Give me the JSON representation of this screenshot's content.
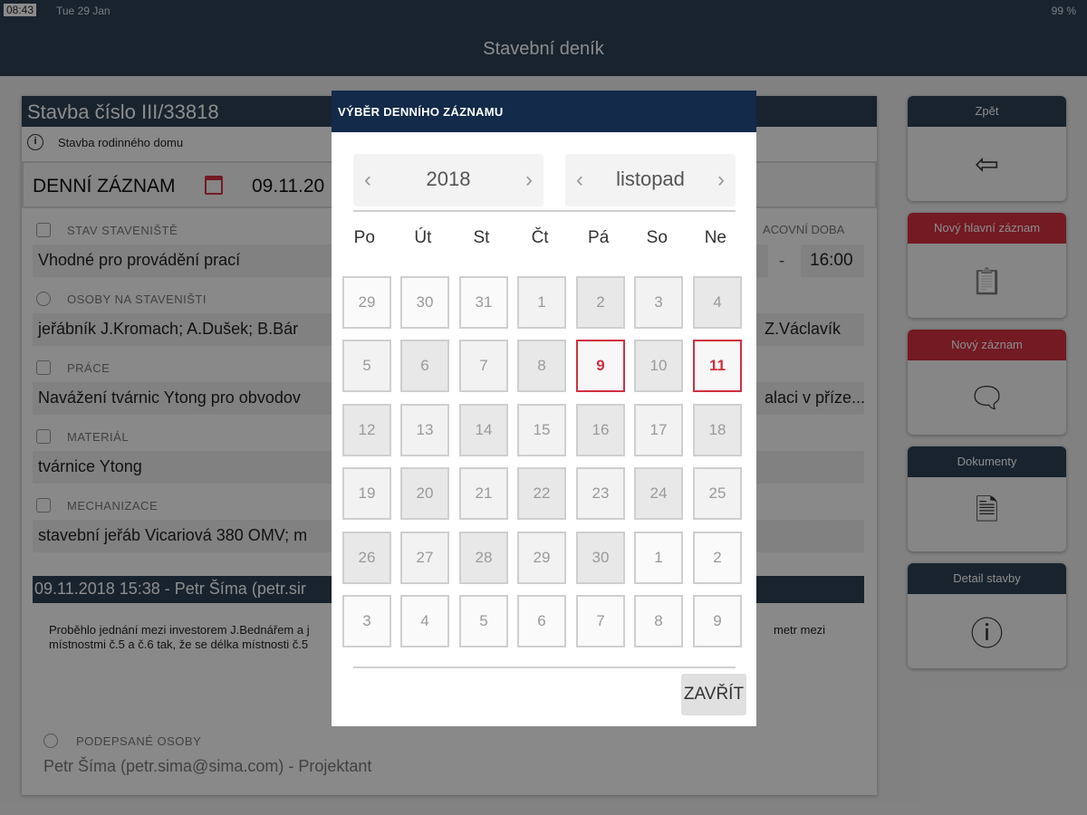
{
  "status": {
    "time": "08:43",
    "date": "Tue 29 Jan",
    "battery": "99 %"
  },
  "nav": {
    "title": "Stavební deník"
  },
  "project": {
    "title": "Stavba číslo III/33818",
    "subtitle": "Stavba rodinného domu",
    "day_record_label": "DENNÍ ZÁZNAM",
    "day_record_date": "09.11.20",
    "sections": {
      "site_state": {
        "label": "STAV STAVENIŠTĚ",
        "value": "Vhodné pro provádění prací"
      },
      "persons": {
        "label": "OSOBY NA STAVENIŠTI",
        "value": "jeřábník J.Kromach;  A.Dušek;  B.Bár",
        "value_right": "Z.Václavík"
      },
      "work": {
        "label": "PRÁCE",
        "value": "Navážení tvárnic Ytong pro obvodov",
        "value_right": "alaci v přízе..."
      },
      "material": {
        "label": "MATERIÁL",
        "value": "tvárnice Ytong"
      },
      "machinery": {
        "label": "MECHANIZACE",
        "value": "stavební jeřáb Vicariová 380 OMV;  m"
      }
    },
    "work_time": {
      "label": "ACOVNÍ DOBA",
      "dash": "-",
      "end": "16:00"
    },
    "entry": {
      "header": "09.11.2018 15:38 - Petr Šíma (petr.sir",
      "text_line1": "Proběhlo jednání mezi investorem J.Bednářem a j",
      "text_line1_right": "metr mezi",
      "text_line2": "místnostmi č.5 a č.6 tak, že se délka místnosti č.5"
    },
    "signed": {
      "label": "PODEPSANÉ OSOBY",
      "value": "Petr Šíma (petr.sima@sima.com) - Projektant"
    }
  },
  "side_buttons": [
    {
      "label": "Zpět",
      "color": "dark",
      "icon": "back-arrow-icon",
      "glyph": "⇦"
    },
    {
      "label": "Nový hlavní záznam",
      "color": "red",
      "icon": "clipboard-icon",
      "glyph": "📋"
    },
    {
      "label": "Nový záznam",
      "color": "red",
      "icon": "comment-icon",
      "glyph": "🗨"
    },
    {
      "label": "Dokumenty",
      "color": "dark",
      "icon": "document-icon",
      "glyph": "🗎"
    },
    {
      "label": "Detail stavby",
      "color": "dark",
      "icon": "info-icon",
      "glyph": "ⓘ"
    }
  ],
  "modal": {
    "title": "VÝBĚR DENNÍHO ZÁZNAMU",
    "year": "2018",
    "month": "listopad",
    "prev_glyph": "‹",
    "next_glyph": "›",
    "weekdays": [
      "Po",
      "Út",
      "St",
      "Čt",
      "Pá",
      "So",
      "Ne"
    ],
    "weeks": [
      [
        "29",
        "30",
        "31",
        "1",
        "2",
        "3",
        "4"
      ],
      [
        "5",
        "6",
        "7",
        "8",
        "9",
        "10",
        "11"
      ],
      [
        "12",
        "13",
        "14",
        "15",
        "16",
        "17",
        "18"
      ],
      [
        "19",
        "20",
        "21",
        "22",
        "23",
        "24",
        "25"
      ],
      [
        "26",
        "27",
        "28",
        "29",
        "30",
        "1",
        "2"
      ],
      [
        "3",
        "4",
        "5",
        "6",
        "7",
        "8",
        "9"
      ]
    ],
    "highlighted_days": [
      "9",
      "11"
    ],
    "close_label": "ZAVŘÍT"
  }
}
